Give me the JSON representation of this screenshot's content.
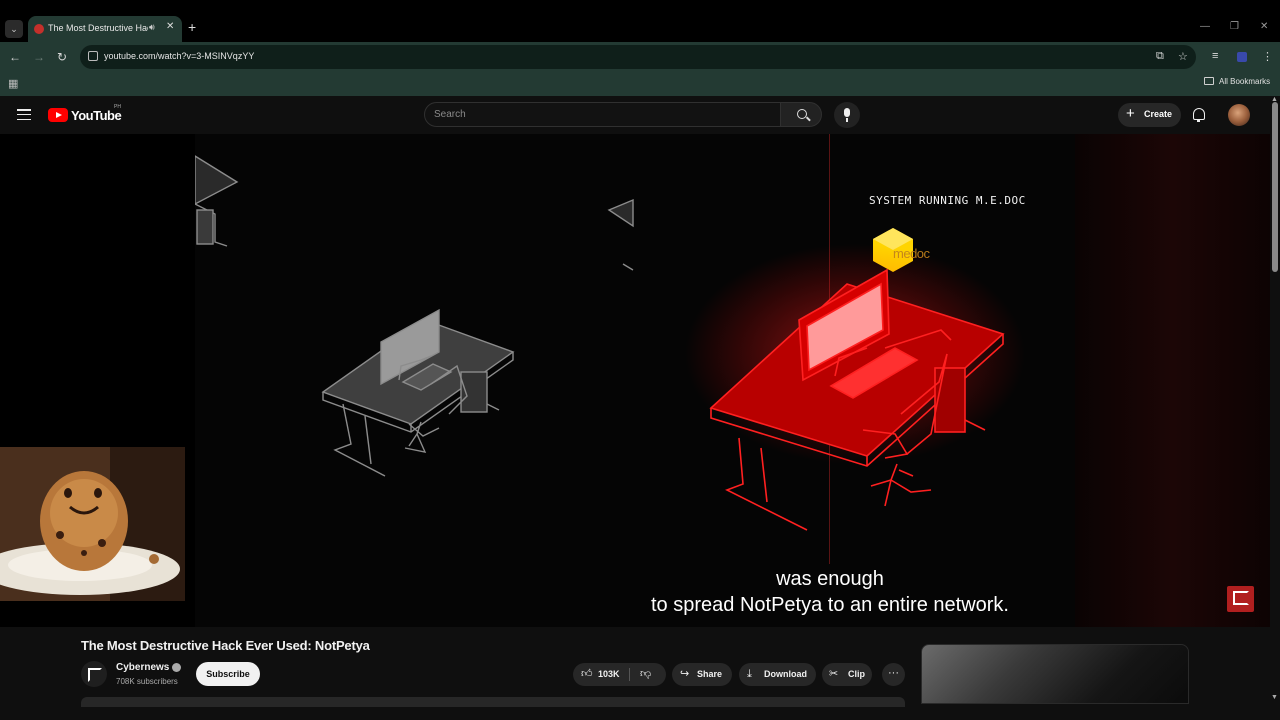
{
  "browser": {
    "tab": {
      "title": "The Most Destructive Hack",
      "close_glyph": "✕",
      "audio_icon": "speaker-icon"
    },
    "new_tab_glyph": "+",
    "url": "youtube.com/watch?v=3-MSINVqzYY",
    "bookmarks": {
      "all_label": "All Bookmarks"
    },
    "window_controls": {
      "minimize": "—",
      "restore": "❐",
      "close": "✕"
    }
  },
  "youtube": {
    "logo_text": "YouTube",
    "country_code": "PH",
    "search": {
      "placeholder": "Search",
      "value": ""
    },
    "create_label": "Create",
    "accent_color": "#ff0000"
  },
  "video": {
    "overlay_text": "SYSTEM RUNNING M.E.DOC",
    "logo_text_a": "me",
    "logo_text_b": "doc",
    "subtitle_line1": "was enough",
    "subtitle_line2": "to spread NotPetya to an entire network."
  },
  "details": {
    "title": "The Most Destructive Hack Ever Used: NotPetya",
    "channel": {
      "name": "Cybernews",
      "subscribers": "708K subscribers"
    },
    "subscribe_label": "Subscribe",
    "likes": "103K",
    "share_label": "Share",
    "download_label": "Download",
    "clip_label": "Clip",
    "more_glyph": "···"
  }
}
